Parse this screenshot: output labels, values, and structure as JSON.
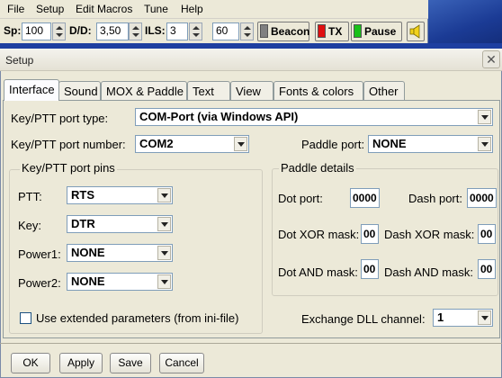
{
  "menu": [
    "File",
    "Setup",
    "Edit Macros",
    "Tune",
    "Help"
  ],
  "toolbar": {
    "sp_label": "Sp:",
    "sp_value": "100",
    "dd_label": "D/D:",
    "dd_value": "3,50",
    "ils_label": "ILS:",
    "ils_value": "3",
    "unnamed_value": "60",
    "beacon": "Beacon",
    "tx": "TX",
    "pause": "Pause",
    "colors": {
      "beacon": "#808080",
      "tx": "#e01010",
      "pause": "#19c019"
    }
  },
  "dialog": {
    "title": "Setup",
    "close_glyph": "✕"
  },
  "tabs": [
    "Interface",
    "Sound",
    "MOX & Paddle",
    "Text",
    "View",
    "Fonts & colors",
    "Other"
  ],
  "interface": {
    "port_type_label": "Key/PTT port type:",
    "port_type_value": "COM-Port (via Windows API)",
    "port_number_label": "Key/PTT port number:",
    "port_number_value": "COM2",
    "paddle_port_label": "Paddle port:",
    "paddle_port_value": "NONE",
    "pins_group": "Key/PTT port pins",
    "pins": [
      {
        "label": "PTT:",
        "value": "RTS"
      },
      {
        "label": "Key:",
        "value": "DTR"
      },
      {
        "label": "Power1:",
        "value": "NONE"
      },
      {
        "label": "Power2:",
        "value": "NONE"
      }
    ],
    "ext_params_label": "Use extended parameters (from ini-file)",
    "paddle_group": "Paddle details",
    "dot_port_label": "Dot port:",
    "dot_port_value": "0000",
    "dash_port_label": "Dash port:",
    "dash_port_value": "0000",
    "dot_xor_label": "Dot XOR mask:",
    "dot_xor_value": "00",
    "dash_xor_label": "Dash XOR mask:",
    "dash_xor_value": "00",
    "dot_and_label": "Dot AND mask:",
    "dot_and_value": "00",
    "dash_and_label": "Dash AND mask:",
    "dash_and_value": "00",
    "dll_label": "Exchange DLL channel:",
    "dll_value": "1"
  },
  "buttons": {
    "ok": "OK",
    "apply": "Apply",
    "save": "Save",
    "cancel": "Cancel"
  }
}
